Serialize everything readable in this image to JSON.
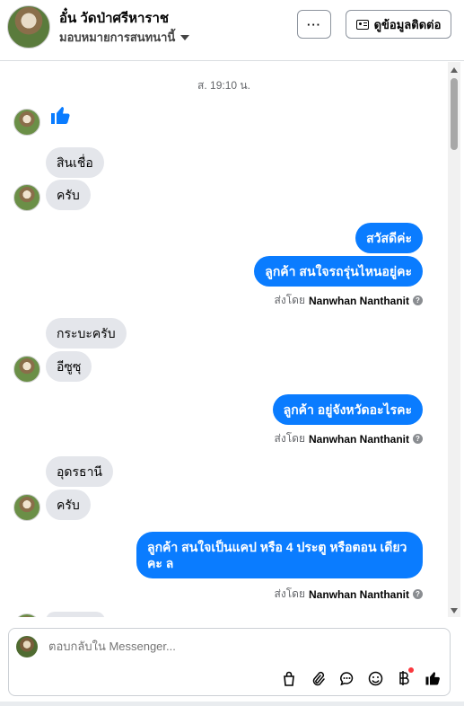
{
  "header": {
    "name": "อั๋น วัดป่าศรีหาราช",
    "assign_label": "มอบหมายการสนทนานี้",
    "more_label": "···",
    "contact_label": "ดูข้อมูลติดต่อ"
  },
  "thread": {
    "timestamp": "ส. 19:10 น.",
    "messages": [
      {
        "side": "in",
        "text": "สินเชื่อ"
      },
      {
        "side": "in",
        "text": "ครับ"
      },
      {
        "side": "out",
        "text": "สวัสดีค่ะ"
      },
      {
        "side": "out",
        "text": "ลูกค้า สนใจรถรุ่นไหนอยู่คะ"
      },
      {
        "side": "in",
        "text": "กระบะครับ"
      },
      {
        "side": "in",
        "text": "อีซูซุ"
      },
      {
        "side": "out",
        "text": "ลูกค้า อยู่จังหวัดอะไรคะ"
      },
      {
        "side": "in",
        "text": "อุดรธานี"
      },
      {
        "side": "in",
        "text": "ครับ"
      },
      {
        "side": "out",
        "text": "ลูกค้า สนใจเป็นแคป หรือ  4 ประตู หรือตอน เดียว คะ  ล"
      }
    ],
    "sent_by_prefix": "ส่งโดย",
    "sent_by_name": "Nanwhan Nanthanit",
    "info_glyph": "?"
  },
  "composer": {
    "placeholder": "ตอบกลับใน Messenger...",
    "tools": [
      "bag-icon",
      "attachment-icon",
      "saved-replies-icon",
      "emoji-icon",
      "baht-icon",
      "like-icon"
    ]
  },
  "colors": {
    "outgoing": "#0a7cff",
    "incoming": "#e4e6eb",
    "notification": "#fa383e"
  }
}
